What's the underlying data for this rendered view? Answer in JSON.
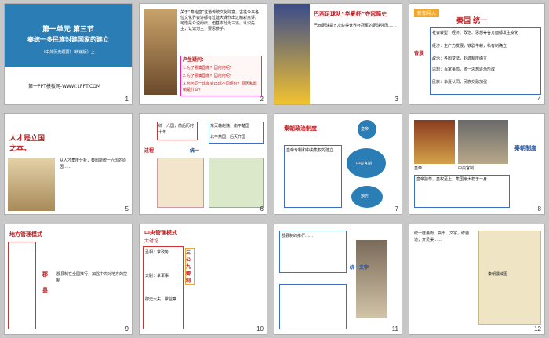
{
  "window": {
    "title": "Slide sorter"
  },
  "slides": [
    {
      "num": "1",
      "title": "第一单元  第三节",
      "subtitle": "秦统一多民族封建国家的建立",
      "source": "《中外历史纲要》（统编版）上",
      "footer": "第一PPT模板网-WWW.1PPT.COM"
    },
    {
      "num": "2",
      "body": "关于“秦始皇”这道传统文化财富。古往今来各位文化界会讲都有过建大课作出过精彩点评。可惜是众说纷纭，但基本分为三派。认识先主，认识为主，要思参乎。",
      "prompt_title": "产生疑问：",
      "q1": "1.为了哪奏国象？因何何呢？",
      "q2": "2.为了哪奏国象？因何何呢？",
      "q3": "3.为何同一现象会出现不同评价？原因和影响是什么？"
    },
    {
      "num": "3",
      "title": "巴西足球队“华夏杯”夺冠简史",
      "body": "巴西足球是五次获得世界杯冠军的足球强国……"
    },
    {
      "num": "4",
      "tag": "新知导入",
      "title": "秦国 统一",
      "side": "背景",
      "items": [
        "社会转型：经济、政治、思想等各方面都发生变化",
        "经济：生产力发展，铁器牛耕，私有制确立",
        "政治：各国变法，封建制度确立",
        "思想：百家争鸣，统一思想逐渐形成",
        "民族：华夏认同，民族交融加强"
      ]
    },
    {
      "num": "5",
      "title": "人才是立国之本。",
      "body": "从人才角度分析，秦国能统一六国的原因……"
    },
    {
      "num": "6",
      "side1": "过程",
      "side2": "统一",
      "c1": "统一六国，前后历时十年",
      "c2": "东灭韩赵魏，南平楚国",
      "c3": "北平燕国，后灭齐国"
    },
    {
      "num": "7",
      "title": "秦朝政治制度",
      "body": "皇帝专制和中央集权的建立",
      "n1": "皇帝",
      "n2": "中央官制",
      "n3": "地方"
    },
    {
      "num": "8",
      "label1": "皇帝",
      "label2": "中央官制",
      "side": "秦朝制度",
      "body": "皇帝独尊，皇权至上，集国家大权于一身"
    },
    {
      "num": "9",
      "title": "地方管理模式",
      "sub1": "郡",
      "sub2": "县",
      "body": "郡县制在全国推行，加强中央对地方的控制"
    },
    {
      "num": "10",
      "title": "中央管理模式",
      "sub": "大讨论",
      "items": [
        "丞相：掌政务",
        "太尉：掌军事",
        "御史大夫：掌监察"
      ],
      "side": "三公九卿制"
    },
    {
      "num": "11",
      "title": "地方行政",
      "caption": "统一文字",
      "body": "郡县制的推行……"
    },
    {
      "num": "12",
      "body": "统一度量衡、货币、文字，修驰道，开灵渠……",
      "map": "秦朝疆域图"
    }
  ],
  "colors": {
    "red": "#c0161a",
    "blue": "#1d4fa0",
    "bg": "#c8c8c8"
  }
}
